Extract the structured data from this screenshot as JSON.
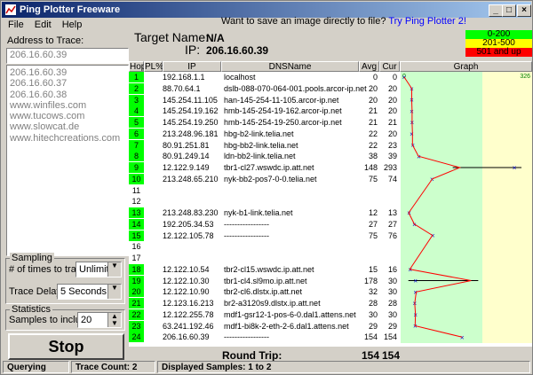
{
  "window": {
    "title": "Ping Plotter Freeware"
  },
  "menu": [
    "File",
    "Edit",
    "Help"
  ],
  "promo": {
    "text": "Want to save an image directly to file?",
    "link": "Try Ping Plotter 2!"
  },
  "sidebar": {
    "address_label": "Address to Trace:",
    "address_value": "206.16.60.39",
    "history": [
      "206.16.60.39",
      "206.16.60.37",
      "206.16.60.38",
      "www.winfiles.com",
      "www.tucows.com",
      "www.slowcat.de",
      "www.hitechcreations.com"
    ],
    "sampling_label": "Sampling",
    "times_label": "# of times to trace:",
    "times_value": "Unlimited",
    "delay_label": "Trace Delay:",
    "delay_value": "5 Seconds",
    "statistics_label": "Statistics",
    "samples_label": "Samples to include:",
    "samples_value": "20",
    "stop_label": "Stop"
  },
  "target": {
    "name_label": "Target Name:",
    "name_value": "N/A",
    "ip_label": "IP:",
    "ip_value": "206.16.60.39"
  },
  "legend": [
    {
      "label": "0-200",
      "color": "#00ff00"
    },
    {
      "label": "201-500",
      "color": "#ffff00"
    },
    {
      "label": "501 and up",
      "color": "#ff0000"
    }
  ],
  "columns": [
    "Hop",
    "PL%",
    "IP",
    "DNSName",
    "Avg",
    "Cur",
    "Graph"
  ],
  "graph_scale": {
    "min": "0",
    "max": "326"
  },
  "hops": [
    {
      "hop": "1",
      "ip": "192.168.1.1",
      "dns": "localhost",
      "avg": "0",
      "cur": "0",
      "green": true
    },
    {
      "hop": "2",
      "ip": "88.70.64.1",
      "dns": "dslb-088-070-064-001.pools.arcor-ip.net",
      "avg": "20",
      "cur": "20",
      "green": true
    },
    {
      "hop": "3",
      "ip": "145.254.11.105",
      "dns": "han-145-254-11-105.arcor-ip.net",
      "avg": "20",
      "cur": "20",
      "green": true
    },
    {
      "hop": "4",
      "ip": "145.254.19.162",
      "dns": "hmb-145-254-19-162.arcor-ip.net",
      "avg": "21",
      "cur": "20",
      "green": true
    },
    {
      "hop": "5",
      "ip": "145.254.19.250",
      "dns": "hmb-145-254-19-250.arcor-ip.net",
      "avg": "21",
      "cur": "21",
      "green": true
    },
    {
      "hop": "6",
      "ip": "213.248.96.181",
      "dns": "hbg-b2-link.telia.net",
      "avg": "22",
      "cur": "20",
      "green": true
    },
    {
      "hop": "7",
      "ip": "80.91.251.81",
      "dns": "hbg-bb2-link.telia.net",
      "avg": "22",
      "cur": "23",
      "green": true
    },
    {
      "hop": "8",
      "ip": "80.91.249.14",
      "dns": "ldn-bb2-link.telia.net",
      "avg": "38",
      "cur": "39",
      "green": true
    },
    {
      "hop": "9",
      "ip": "12.122.9.149",
      "dns": "tbr1-cl27.wswdc.ip.att.net",
      "avg": "148",
      "cur": "293",
      "green": true
    },
    {
      "hop": "10",
      "ip": "213.248.65.210",
      "dns": "nyk-bb2-pos7-0-0.telia.net",
      "avg": "75",
      "cur": "74",
      "green": true
    },
    {
      "hop": "11",
      "ip": "",
      "dns": "",
      "avg": "",
      "cur": "",
      "green": false
    },
    {
      "hop": "12",
      "ip": "",
      "dns": "",
      "avg": "",
      "cur": "",
      "green": false
    },
    {
      "hop": "13",
      "ip": "213.248.83.230",
      "dns": "nyk-b1-link.telia.net",
      "avg": "12",
      "cur": "13",
      "green": true
    },
    {
      "hop": "14",
      "ip": "192.205.34.53",
      "dns": "-----------------",
      "avg": "27",
      "cur": "27",
      "green": true
    },
    {
      "hop": "15",
      "ip": "12.122.105.78",
      "dns": "-----------------",
      "avg": "75",
      "cur": "76",
      "green": true
    },
    {
      "hop": "16",
      "ip": "",
      "dns": "",
      "avg": "",
      "cur": "",
      "green": false
    },
    {
      "hop": "17",
      "ip": "",
      "dns": "",
      "avg": "",
      "cur": "",
      "green": false
    },
    {
      "hop": "18",
      "ip": "12.122.10.54",
      "dns": "tbr2-cl15.wswdc.ip.att.net",
      "avg": "15",
      "cur": "16",
      "green": true
    },
    {
      "hop": "19",
      "ip": "12.122.10.30",
      "dns": "tbr1-cl4.sl9mo.ip.att.net",
      "avg": "178",
      "cur": "30",
      "green": true
    },
    {
      "hop": "20",
      "ip": "12.122.10.90",
      "dns": "tbr2-cl6.dlstx.ip.att.net",
      "avg": "32",
      "cur": "30",
      "green": true
    },
    {
      "hop": "21",
      "ip": "12.123.16.213",
      "dns": "br2-a3120s9.dlstx.ip.att.net",
      "avg": "28",
      "cur": "28",
      "green": true
    },
    {
      "hop": "22",
      "ip": "12.122.255.78",
      "dns": "mdf1-gsr12-1-pos-6-0.dal1.attens.net",
      "avg": "30",
      "cur": "30",
      "green": true
    },
    {
      "hop": "23",
      "ip": "63.241.192.46",
      "dns": "mdf1-bi8k-2-eth-2-6.dal1.attens.net",
      "avg": "29",
      "cur": "29",
      "green": true
    },
    {
      "hop": "24",
      "ip": "206.16.60.39",
      "dns": "-----------------",
      "avg": "154",
      "cur": "154",
      "green": true
    }
  ],
  "round_trip": {
    "label": "Round Trip:",
    "avg": "154",
    "cur": "154"
  },
  "status": {
    "state": "Querying",
    "trace_count": "Trace Count: 2",
    "displayed": "Displayed Samples: 1 to 2"
  }
}
